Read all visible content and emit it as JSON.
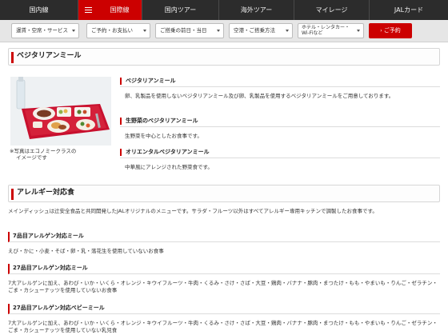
{
  "nav": {
    "tabs": [
      {
        "label": "国内線",
        "active": false
      },
      {
        "label": "国際線",
        "active": true
      },
      {
        "label": "国内ツアー",
        "active": false
      },
      {
        "label": "海外ツアー",
        "active": false
      },
      {
        "label": "マイレージ",
        "active": false
      },
      {
        "label": "JALカード",
        "active": false
      }
    ]
  },
  "subnav": {
    "selects": [
      "運賃・空席・サービス",
      "ご予約・お支払い",
      "ご搭乗の前日・当日",
      "空港・ご搭乗方法",
      "ホテル・レンタカー・Wi-Fiなど"
    ],
    "go_label": "ご予約"
  },
  "vegetarian": {
    "heading": "ベジタリアンミール",
    "caption_line1": "※写真はエコノミークラスの",
    "caption_line2": "イメージです",
    "items": [
      {
        "title": "ベジタリアンミール",
        "text": "卵、乳製品を使用しないベジタリアンミール及び卵、乳製品を使用するベジタリアンミールをご用意しております。"
      },
      {
        "title": "生野菜のベジタリアンミール",
        "text": "生野菜を中心としたお食事です。"
      },
      {
        "title": "オリエンタルベジタリアンミール",
        "text": "中華風にアレンジされた野菜食です。"
      }
    ]
  },
  "allergy": {
    "heading": "アレルギー対応食",
    "intro": "メインディッシュは辻安全食品と共同開発したJALオリジナルのメニューです。サラダ・フルーツ以外はすべてアレルギー専用キッチンで調製したお食事です。",
    "items": [
      {
        "title": "7品目アレルゲン対応ミール",
        "text": "えび・かに・小麦・そば・卵・乳・落花生を使用していないお食事"
      },
      {
        "title": "27品目アレルゲン対応ミール",
        "text": "7大アレルゲンに加え、あわび・いか・いくら・オレンジ・キウイフルーツ・牛肉・くるみ・さけ・さば・大豆・鶏肉・バナナ・豚肉・まつたけ・もも・やまいも・りんご・ゼラチン・ごま・カシューナッツを使用していないお食事"
      },
      {
        "title": "27品目アレルゲン対応ベビーミール",
        "text": "7大アレルゲンに加え、あわび・いか・いくら・オレンジ・キウイフルーツ・牛肉・くるみ・さけ・さば・大豆・鶏肉・バナナ・豚肉・まつたけ・もも・やまいも・りんご・ゼラチン・ごま・カシューナッツを使用していない乳児食"
      }
    ]
  },
  "colors": {
    "accent": "#cc0000",
    "nav_bg": "#2c2c2c"
  }
}
